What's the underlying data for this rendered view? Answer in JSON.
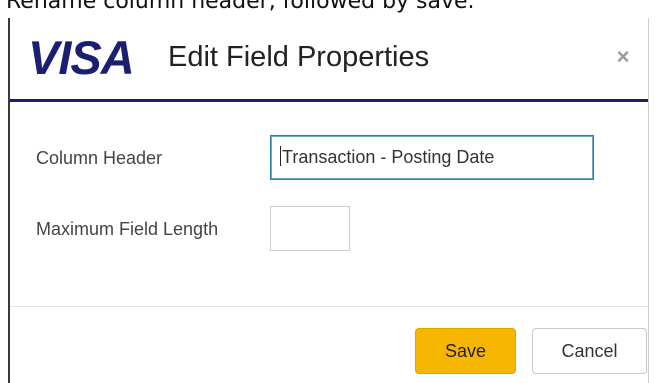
{
  "caption": "Rename column header, followed by save.",
  "dialog": {
    "logo_text": "VISA",
    "title": "Edit Field Properties",
    "close_label": "×"
  },
  "fields": {
    "column_header": {
      "label": "Column Header",
      "value": "Transaction - Posting Date"
    },
    "max_length": {
      "label": "Maximum Field Length",
      "value": ""
    }
  },
  "footer": {
    "save_label": "Save",
    "cancel_label": "Cancel"
  },
  "colors": {
    "visa_blue": "#1a1f71",
    "save_button": "#f7b600",
    "input_focus_border": "#2f7fa8"
  },
  "icons": {
    "close": "close-icon",
    "resize": "resize-grip-icon"
  }
}
